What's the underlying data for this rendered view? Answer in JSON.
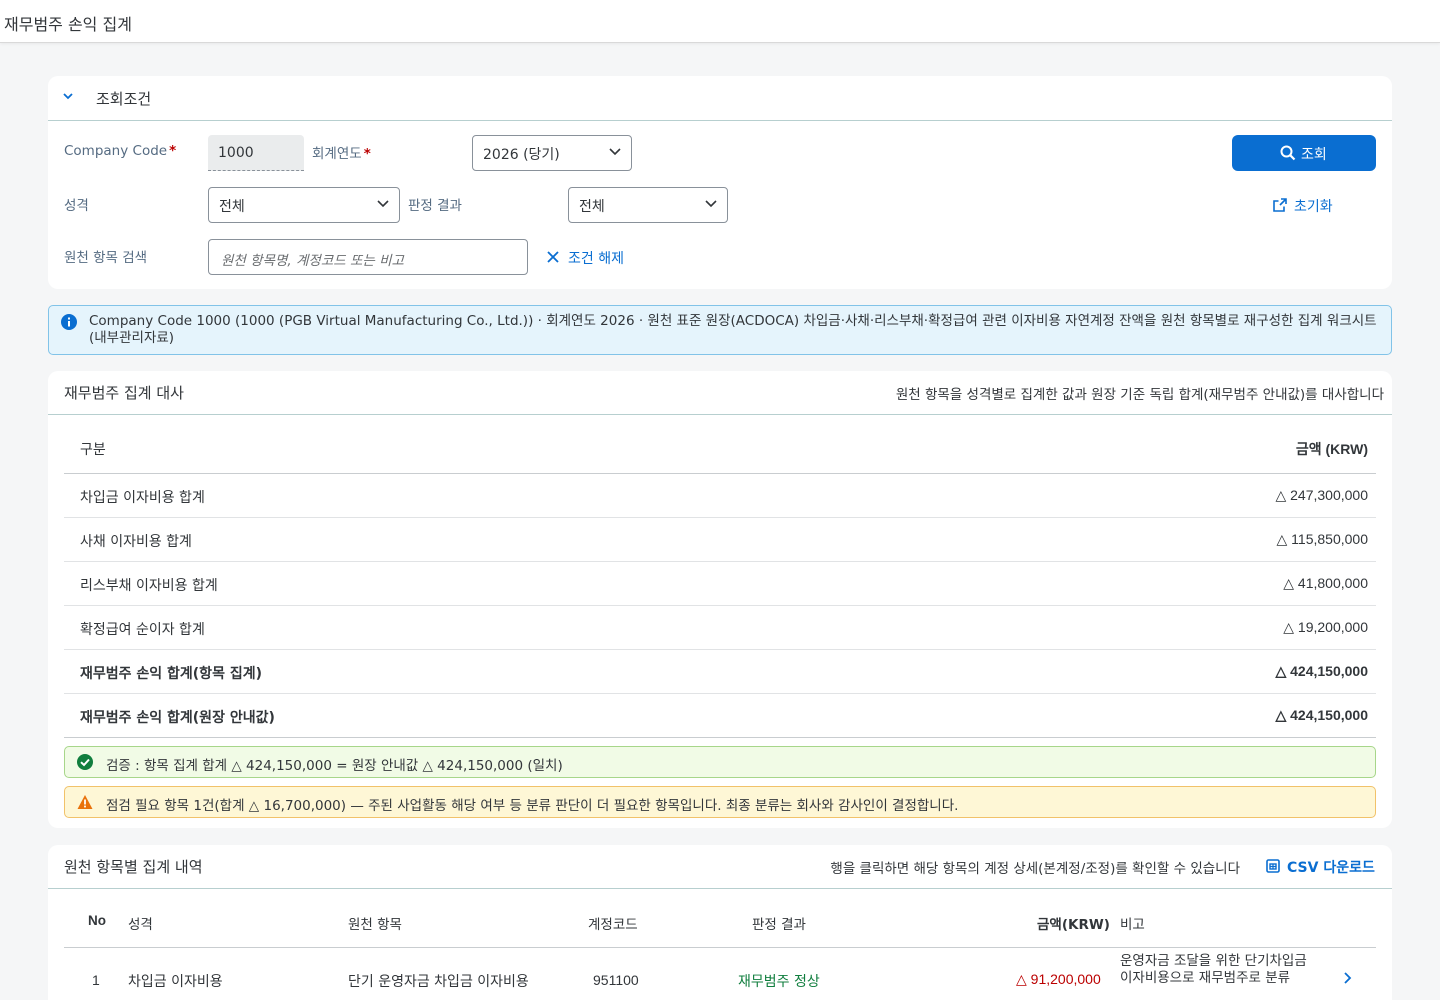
{
  "app": {
    "title": "재무범주 손익 집계"
  },
  "filter": {
    "title": "조회조건",
    "company_code_label": "Company Code",
    "company_code_value": "1000",
    "fiscal_year_label": "회계연도",
    "fiscal_year_value": "2026 (당기)",
    "nature_label": "성격",
    "nature_value": "전체",
    "judgment_label": "판정 결과",
    "judgment_value": "전체",
    "search_label": "원천 항목 검색",
    "search_placeholder": "원천 항목명, 계정코드 또는 비고",
    "clear_label": "조건 해제",
    "search_button": "조회",
    "reset_button": "초기화",
    "required_mark": "*"
  },
  "info": {
    "text": "Company Code 1000 (1000 (PGB Virtual Manufacturing Co., Ltd.)) · 회계연도 2026 · 원천 표준 원장(ACDOCA) 차입금·사채·리스부채·확정급여 관련 이자비용 자연계정 잔액을 원천 항목별로 재구성한 집계 워크시트(내부관리자료)"
  },
  "summary": {
    "title": "재무범주 집계 대사",
    "note": "원천 항목을 성격별로 집계한 값과 원장 기준 독립 합계(재무범주 안내값)를 대사합니다",
    "col_label": "구분",
    "col_amount": "금액 (KRW)",
    "rows": [
      {
        "label": "차입금 이자비용 합계",
        "amount": "△ 247,300,000"
      },
      {
        "label": "사채 이자비용 합계",
        "amount": "△ 115,850,000"
      },
      {
        "label": "리스부채 이자비용 합계",
        "amount": "△ 41,800,000"
      },
      {
        "label": "확정급여 순이자 합계",
        "amount": "△ 19,200,000"
      },
      {
        "label": "재무범주 손익 합계(항목 집계)",
        "amount": "△ 424,150,000"
      },
      {
        "label": "재무범주 손익 합계(원장 안내값)",
        "amount": "△ 424,150,000"
      }
    ],
    "success_msg": "검증 : 항목 집계 합계 △ 424,150,000 = 원장 안내값 △ 424,150,000 (일치)",
    "warning_msg": "점검 필요 항목 1건(합계 △ 16,700,000) — 주된 사업활동 해당 여부 등 분류 판단이 더 필요한 항목입니다. 최종 분류는 회사와 감사인이 결정합니다."
  },
  "detail": {
    "title": "원천 항목별 집계 내역",
    "note": "행을 클릭하면 해당 항목의 계정 상세(본계정/조정)를 확인할 수 있습니다",
    "csv_label": "CSV 다운로드",
    "headers": {
      "no": "No",
      "nature": "성격",
      "item": "원천 항목",
      "account": "계정코드",
      "judgment": "판정 결과",
      "amount": "금액(KRW)",
      "remark": "비고"
    },
    "rows": [
      {
        "no": "1",
        "nature": "차입금 이자비용",
        "item": "단기 운영자금 차입금 이자비용",
        "account": "951100",
        "judgment": "재무범주 정상",
        "amount": "△ 91,200,000",
        "remark": "운영자금 조달을 위한 단기차입금 이자비용으로 재무범주로 분류"
      }
    ]
  },
  "colors": {
    "accent": "#0a6ed1",
    "success": "#107e3e",
    "negative": "#bb0000",
    "warning": "#e9730c"
  }
}
